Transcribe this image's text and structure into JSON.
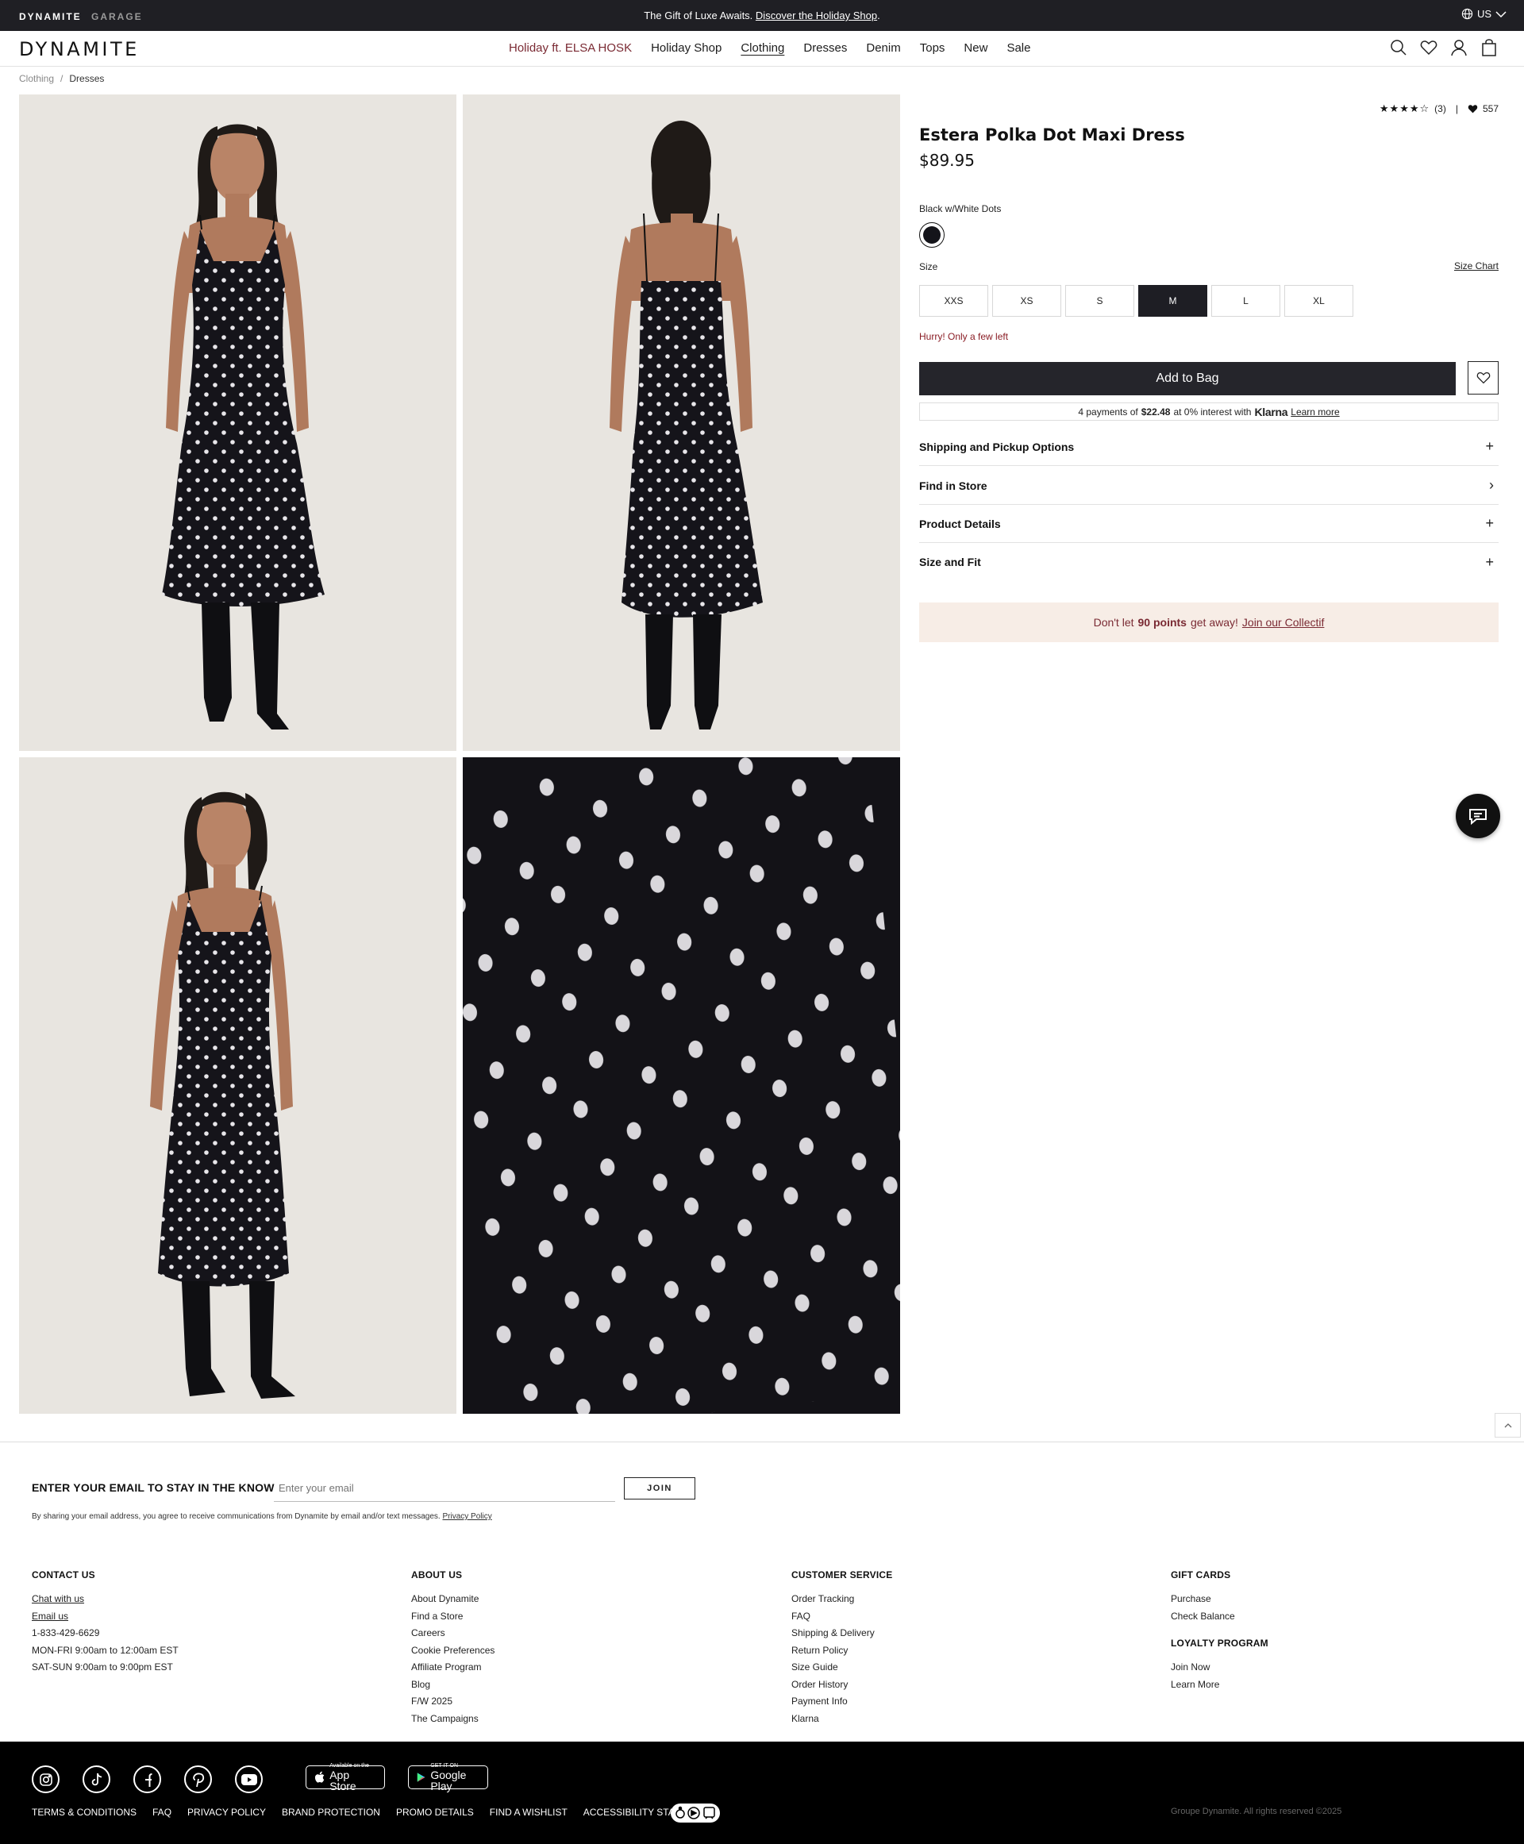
{
  "promo_bar": {
    "brands": [
      "DYNAMITE",
      "GARAGE"
    ],
    "message": "The Gift of Luxe Awaits.",
    "message_link": "Discover the Holiday Shop",
    "message_tail": ".",
    "locale": "US"
  },
  "header": {
    "logo": "DYNAMITE",
    "nav": [
      "Holiday ft. ELSA HOSK",
      "Holiday Shop",
      "Clothing",
      "Dresses",
      "Denim",
      "Tops",
      "New",
      "Sale"
    ],
    "active_nav": "Clothing",
    "icons": [
      "search-icon",
      "heart-icon",
      "user-icon",
      "bag-icon"
    ]
  },
  "breadcrumb": {
    "parent": "Clothing",
    "separator": "/",
    "current": "Dresses"
  },
  "product": {
    "rating_stars": "★★★★☆",
    "rating_value": 4.5,
    "review_count": "(3)",
    "divider": "|",
    "likes": "557",
    "title": "Estera Polka Dot Maxi Dress",
    "price": "$89.95",
    "color_name": "Black w/White Dots",
    "size_label": "Size",
    "size_chart": "Size Chart",
    "sizes": [
      "XXS",
      "XS",
      "S",
      "M",
      "L",
      "XL"
    ],
    "selected_size": "M",
    "stock_message": "Hurry! Only a few left",
    "add_to_bag": "Add to Bag",
    "klarna": {
      "prefix": "4 payments of",
      "amount": "$22.48",
      "middle": "at 0% interest with",
      "brand": "Klarna",
      "learn_more": "Learn more"
    },
    "accordions": [
      {
        "title": "Shipping and Pickup Options",
        "icon": "+"
      },
      {
        "title": "Find in Store",
        "icon": "›"
      },
      {
        "title": "Product Details",
        "icon": "+"
      },
      {
        "title": "Size and Fit",
        "icon": "+"
      }
    ],
    "loyalty": {
      "prefix": "Don't let",
      "points": "90 points",
      "middle": "get away!",
      "link": "Join our Collectif"
    }
  },
  "colors": {
    "dark": "#1f1f24",
    "accent_maroon": "#7a2a33",
    "alert_red": "#8a1d25",
    "loyalty_bg": "#f7ede6",
    "dress_black": "#14141a"
  },
  "newsletter": {
    "title": "ENTER YOUR EMAIL TO STAY IN THE KNOW",
    "placeholder": "Enter your email",
    "button": "JOIN",
    "legal": "By sharing your email address, you agree to receive communications from Dynamite by email and/or text messages.",
    "legal_link": "Privacy Policy"
  },
  "footer": {
    "contact": {
      "title": "CONTACT US",
      "chat": "Chat with us",
      "email": "Email us",
      "phone": "1-833-429-6629",
      "hours1": "MON-FRI 9:00am to 12:00am EST",
      "hours2": "SAT-SUN 9:00am to 9:00pm EST"
    },
    "about": {
      "title": "ABOUT US",
      "links": [
        "About Dynamite",
        "Find a Store",
        "Careers",
        "Cookie Preferences",
        "Affiliate Program",
        "Blog",
        "F/W 2025",
        "The Campaigns"
      ]
    },
    "customer_service": {
      "title": "CUSTOMER SERVICE",
      "links": [
        "Order Tracking",
        "FAQ",
        "Shipping & Delivery",
        "Return Policy",
        "Size Guide",
        "Order History",
        "Payment Info",
        "Klarna"
      ]
    },
    "gift_cards": {
      "title": "GIFT CARDS",
      "links": [
        "Purchase",
        "Check Balance"
      ]
    },
    "loyalty_program": {
      "title": "LOYALTY PROGRAM",
      "links": [
        "Join Now",
        "Learn More"
      ]
    },
    "socials": [
      "instagram-icon",
      "tiktok-icon",
      "facebook-icon",
      "pinterest-icon",
      "youtube-icon"
    ],
    "app_store": {
      "small": "Available on the",
      "big": "App Store"
    },
    "google_play": {
      "small": "GET IT ON",
      "big": "Google Play"
    },
    "legal_links": [
      "TERMS & CONDITIONS",
      "FAQ",
      "PRIVACY POLICY",
      "BRAND PROTECTION",
      "PROMO DETAILS",
      "FIND A WISHLIST",
      "ACCESSIBILITY STATEMENT"
    ],
    "copyright": "Groupe Dynamite. All rights reserved ©2025"
  }
}
